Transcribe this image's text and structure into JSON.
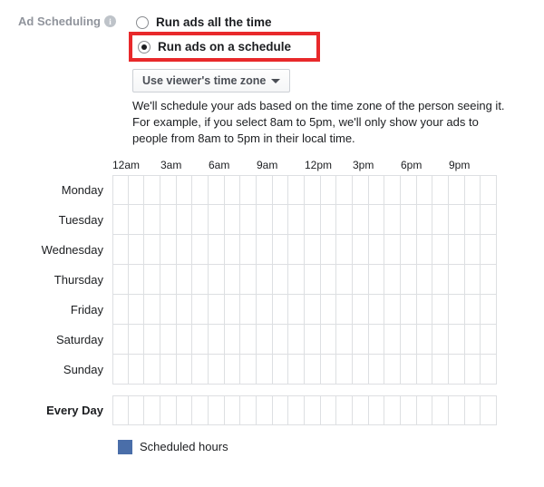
{
  "section": {
    "label": "Ad Scheduling"
  },
  "options": {
    "all_time": "Run ads all the time",
    "schedule": "Run ads on a schedule"
  },
  "timezone": {
    "selected": "Use viewer's time zone"
  },
  "help": {
    "l1": "We'll schedule your ads based on the time zone of the person seeing it.",
    "l2": "For example, if you select 8am to 5pm, we'll only show your ads to people from 8am to 5pm in their local time."
  },
  "hours": [
    "12am",
    "3am",
    "6am",
    "9am",
    "12pm",
    "3pm",
    "6pm",
    "9pm"
  ],
  "days": [
    "Monday",
    "Tuesday",
    "Wednesday",
    "Thursday",
    "Friday",
    "Saturday",
    "Sunday"
  ],
  "every_day": "Every Day",
  "legend": {
    "scheduled": "Scheduled hours"
  }
}
